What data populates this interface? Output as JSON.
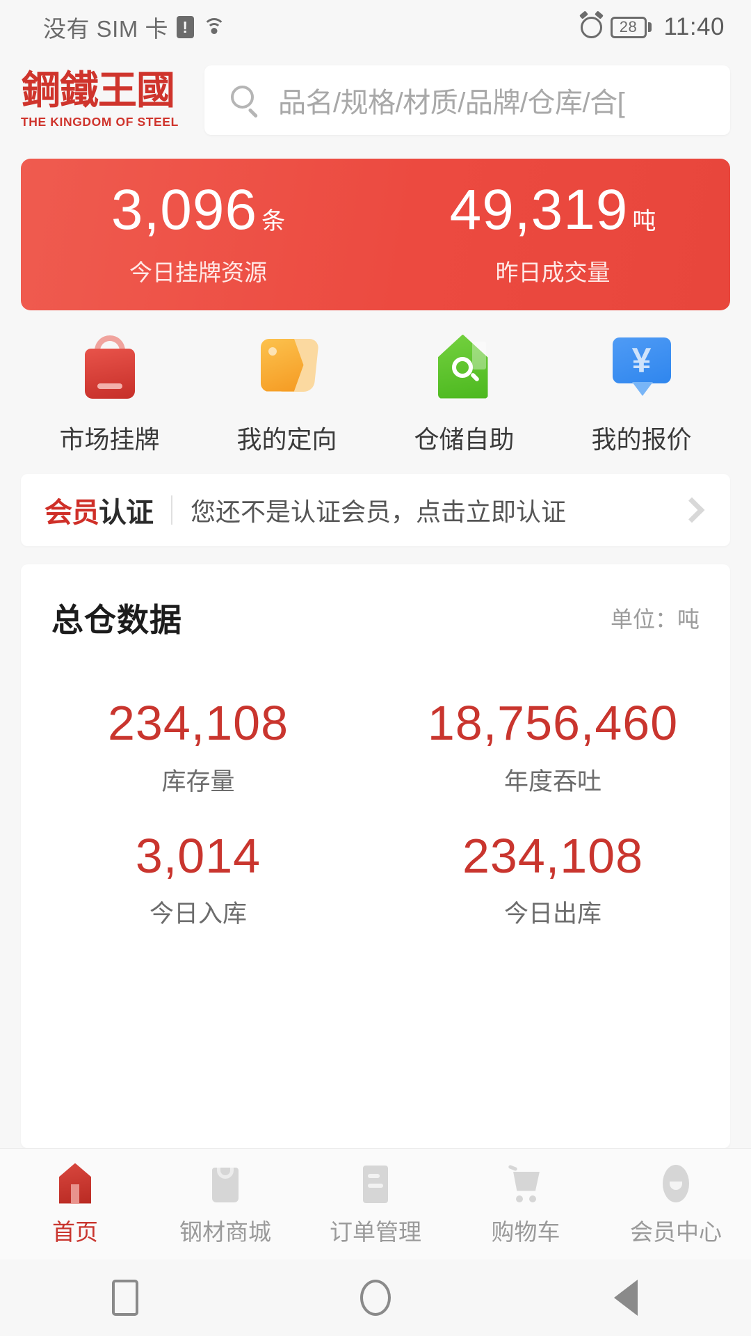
{
  "statusbar": {
    "carrier": "没有 SIM 卡",
    "sim_warning_icon": "warning-icon",
    "wifi_icon": "wifi-icon",
    "alarm_icon": "alarm-icon",
    "battery_level": "28",
    "time": "11:40"
  },
  "header": {
    "logo_cn": "鋼鐵王國",
    "logo_en": "THE KINGDOM OF STEEL",
    "search": {
      "icon": "search-icon",
      "placeholder": "品名/规格/材质/品牌/仓库/合[",
      "value": ""
    }
  },
  "banner": {
    "accent_color": "#EC5046",
    "stats": [
      {
        "value": "3,096",
        "unit": "条",
        "label": "今日挂牌资源"
      },
      {
        "value": "49,319",
        "unit": "吨",
        "label": "昨日成交量"
      }
    ]
  },
  "quick_actions": [
    {
      "icon": "shopping-bag-icon",
      "label": "市场挂牌",
      "color": "#D8453C"
    },
    {
      "icon": "price-tag-icon",
      "label": "我的定向",
      "color": "#F7A92C"
    },
    {
      "icon": "warehouse-search-icon",
      "label": "仓储自助",
      "color": "#5CC22A"
    },
    {
      "icon": "yen-bubble-icon",
      "label": "我的报价",
      "color": "#3C8FF0"
    }
  ],
  "member_banner": {
    "badge_prefix": "会员",
    "badge_suffix": "认证",
    "message": "您还不是认证会员，点击立即认证",
    "chevron_icon": "chevron-right-icon"
  },
  "warehouse_card": {
    "title": "总仓数据",
    "unit_note": "单位：吨",
    "value_color": "#C9352E",
    "stats": [
      {
        "value": "234,108",
        "label": "库存量"
      },
      {
        "value": "18,756,460",
        "label": "年度吞吐"
      },
      {
        "value": "3,014",
        "label": "今日入库"
      },
      {
        "value": "234,108",
        "label": "今日出库"
      }
    ]
  },
  "tabbar": {
    "active_color": "#C9352E",
    "items": [
      {
        "icon": "home-icon",
        "label": "首页",
        "active": true
      },
      {
        "icon": "shop-bag-icon",
        "label": "钢材商城",
        "active": false
      },
      {
        "icon": "order-doc-icon",
        "label": "订单管理",
        "active": false
      },
      {
        "icon": "shopping-cart-icon",
        "label": "购物车",
        "active": false
      },
      {
        "icon": "user-circle-icon",
        "label": "会员中心",
        "active": false
      }
    ]
  },
  "android_nav": {
    "recents_icon": "square-icon",
    "home_icon": "circle-icon",
    "back_icon": "triangle-back-icon"
  }
}
